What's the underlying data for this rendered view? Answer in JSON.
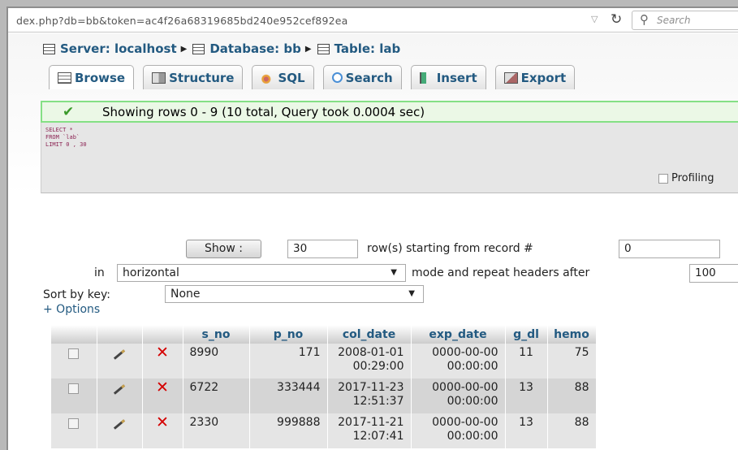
{
  "browser": {
    "url": "dex.php?db=bb&token=ac4f26a68319685bd240e952cef892ea",
    "search_placeholder": "Search"
  },
  "breadcrumb": {
    "server": "Server: localhost",
    "database": "Database: bb",
    "table": "Table: lab"
  },
  "tabs": [
    {
      "label": "Browse",
      "active": true
    },
    {
      "label": "Structure"
    },
    {
      "label": "SQL"
    },
    {
      "label": "Search"
    },
    {
      "label": "Insert"
    },
    {
      "label": "Export"
    }
  ],
  "message": {
    "text": "Showing rows 0 - 9 (10 total, Query took 0.0004 sec)",
    "color": "#85e085"
  },
  "sql": {
    "query": "SELECT *\nFROM `lab`\nLIMIT 0 , 30",
    "profiling_label": "Profiling"
  },
  "controls": {
    "show_button": "Show :",
    "rows_value": "30",
    "row_start_label": "row(s) starting from record #",
    "record_value": "0",
    "in_label": "in",
    "mode_value": "horizontal",
    "mode_label": "mode and repeat headers after",
    "headers_value": "100",
    "sort_label": "Sort by key:",
    "sort_value": "None",
    "options_link": "+ Options"
  },
  "table": {
    "columns": [
      "s_no",
      "p_no",
      "col_date",
      "exp_date",
      "g_dl",
      "hemo"
    ],
    "rows": [
      {
        "s_no": "8990",
        "p_no": "171",
        "col_date_d": "2008-01-01",
        "col_date_t": "00:29:00",
        "exp_date_d": "0000-00-00",
        "exp_date_t": "00:00:00",
        "g_dl": "11",
        "hemo": "75"
      },
      {
        "s_no": "6722",
        "p_no": "333444",
        "col_date_d": "2017-11-23",
        "col_date_t": "12:51:37",
        "exp_date_d": "0000-00-00",
        "exp_date_t": "00:00:00",
        "g_dl": "13",
        "hemo": "88"
      },
      {
        "s_no": "2330",
        "p_no": "999888",
        "col_date_d": "2017-11-21",
        "col_date_t": "12:07:41",
        "exp_date_d": "0000-00-00",
        "exp_date_t": "00:00:00",
        "g_dl": "13",
        "hemo": "88"
      }
    ]
  },
  "icons": {
    "edit": "pencil-icon",
    "delete": "red-x-icon",
    "delete_color": "#d40000",
    "link_color": "#235a81"
  }
}
